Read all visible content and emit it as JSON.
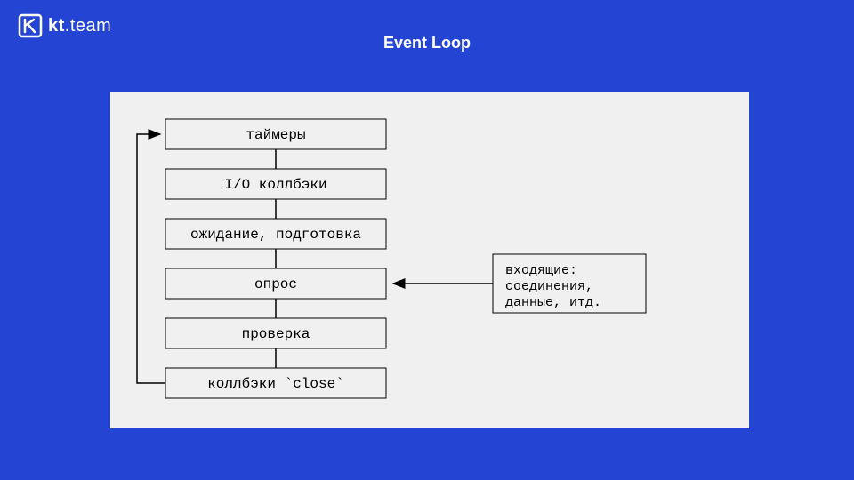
{
  "brand": {
    "name_bold": "kt",
    "name_light": ".team"
  },
  "slide": {
    "title": "Event Loop"
  },
  "diagram": {
    "phases": [
      {
        "label": "таймеры"
      },
      {
        "label": "I/O коллбэки"
      },
      {
        "label": "ожидание, подготовка"
      },
      {
        "label": "опрос"
      },
      {
        "label": "проверка"
      },
      {
        "label": "коллбэки `close`"
      }
    ],
    "side_box": {
      "line1": "входящие:",
      "line2": "соединения,",
      "line3": "данные, итд."
    }
  }
}
